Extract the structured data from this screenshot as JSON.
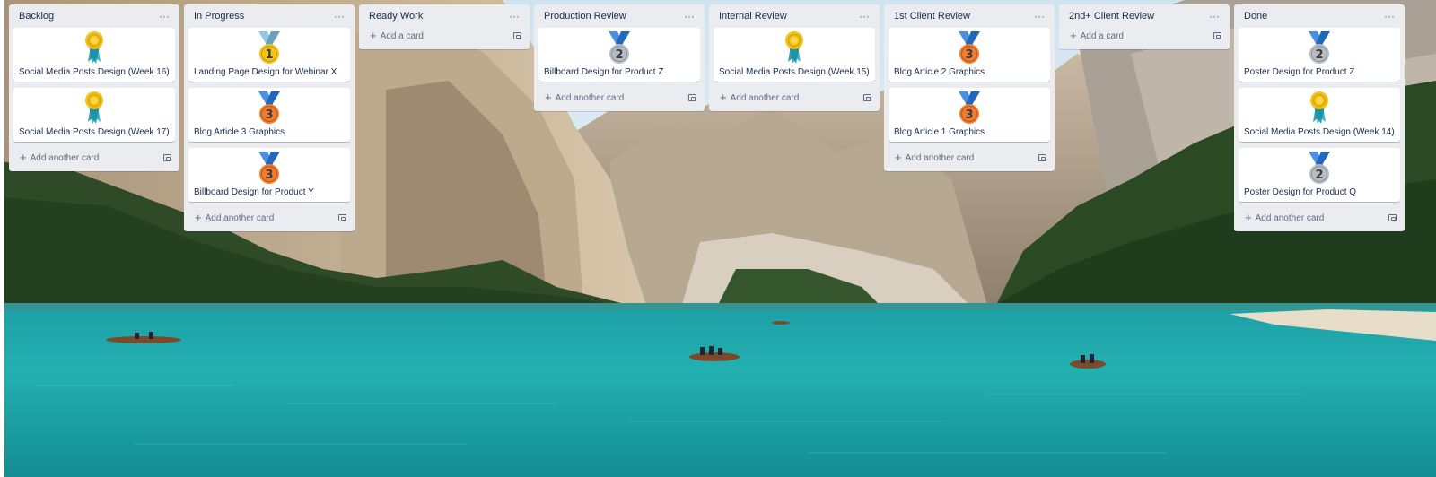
{
  "colors": {
    "list_bg": "#ebecf0",
    "card_bg": "#ffffff",
    "text": "#172b4d",
    "muted": "#5e6c84",
    "medal_gold": "#f2c31a",
    "medal_silver": "#b8bcc4",
    "medal_bronze": "#f07c32",
    "ribbon_teal": "#3fb5c9",
    "ribbon_blue": "#4a90e2"
  },
  "board": {
    "lists": [
      {
        "title": "Backlog",
        "menu": "···",
        "footer": "Add another card",
        "cards": [
          {
            "title": "Social Media Posts Design (Week 16)",
            "icon": "award-rosette-icon"
          },
          {
            "title": "Social Media Posts Design (Week 17)",
            "icon": "award-rosette-icon"
          }
        ]
      },
      {
        "title": "In Progress",
        "menu": "···",
        "footer": "Add another card",
        "cards": [
          {
            "title": "Landing Page Design for Webinar X",
            "icon": "gold-medal-1-icon"
          },
          {
            "title": "Blog Article 3 Graphics",
            "icon": "bronze-medal-3-icon"
          },
          {
            "title": "Billboard Design for Product Y",
            "icon": "bronze-medal-3-icon"
          }
        ]
      },
      {
        "title": "Ready Work",
        "menu": "···",
        "footer": "Add a card",
        "cards": []
      },
      {
        "title": "Production Review",
        "menu": "···",
        "footer": "Add another card",
        "cards": [
          {
            "title": "Billboard Design for Product Z",
            "icon": "silver-medal-2-icon"
          }
        ]
      },
      {
        "title": "Internal Review",
        "menu": "···",
        "footer": "Add another card",
        "cards": [
          {
            "title": "Social Media Posts Design (Week 15)",
            "icon": "award-rosette-icon"
          }
        ]
      },
      {
        "title": "1st Client Review",
        "menu": "···",
        "footer": "Add another card",
        "cards": [
          {
            "title": "Blog Article 2 Graphics",
            "icon": "bronze-medal-3-icon"
          },
          {
            "title": "Blog Article 1 Graphics",
            "icon": "bronze-medal-3-icon"
          }
        ]
      },
      {
        "title": "2nd+ Client Review",
        "menu": "···",
        "footer": "Add a card",
        "cards": []
      },
      {
        "title": "Done",
        "menu": "···",
        "footer": "Add another card",
        "cards": [
          {
            "title": "Poster Design for Product Z",
            "icon": "silver-medal-2-icon"
          },
          {
            "title": "Social Media Posts Design (Week 14)",
            "icon": "award-rosette-icon"
          },
          {
            "title": "Poster Design for Product Q",
            "icon": "silver-medal-2-icon"
          }
        ]
      }
    ]
  }
}
